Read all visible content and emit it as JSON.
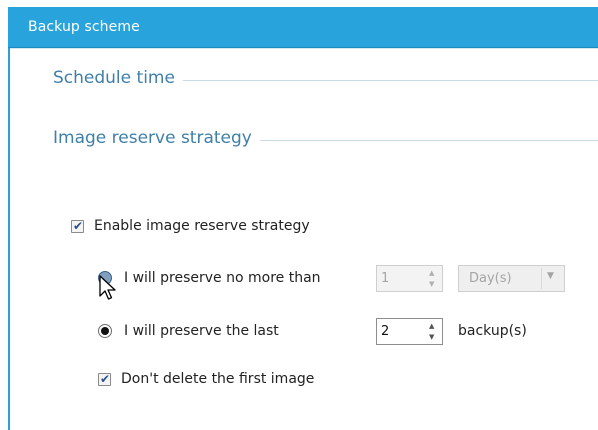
{
  "window": {
    "title": "Backup scheme"
  },
  "sections": {
    "schedule_time": "Schedule time",
    "image_reserve": "Image reserve strategy"
  },
  "enable_strategy": {
    "label": "Enable image reserve strategy",
    "checked": true
  },
  "option_no_more_than": {
    "label": "I will preserve no more than",
    "selected": false,
    "value": "1",
    "unit": "Day(s)"
  },
  "option_preserve_last": {
    "label": "I will preserve the last",
    "selected": true,
    "value": "2",
    "unit": "backup(s)"
  },
  "keep_first": {
    "label": "Don't delete the first image",
    "checked": true
  },
  "colors": {
    "titlebar": "#28a3db",
    "section_text": "#3f7fa8"
  }
}
